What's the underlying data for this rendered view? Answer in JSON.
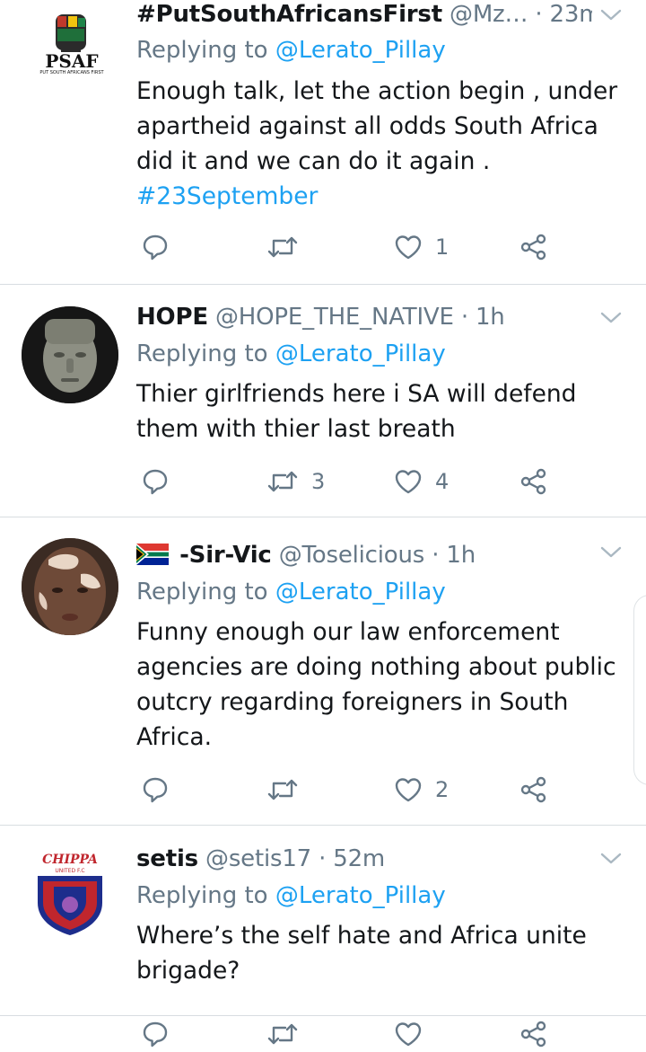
{
  "tweets": [
    {
      "name": "#PutSouthAfricansFirst",
      "handle": "@Mz…",
      "dot": "·",
      "time": "23m",
      "replying_prefix": "Replying to ",
      "replying_to": "@Lerato_Pillay",
      "text": "Enough talk, let the action begin , under\napartheid against all odds South Africa\ndid it and we can do it again .",
      "hashtag": "#23September",
      "avatar_logo_text": "PSAF",
      "avatar_logo_sub": "PUT SOUTH AFRICANS FIRST",
      "retweets": "",
      "likes": "1"
    },
    {
      "name": "HOPE",
      "handle": "@HOPE_THE_NATIVE",
      "dot": "·",
      "time": "1h",
      "replying_prefix": "Replying to ",
      "replying_to": "@Lerato_Pillay",
      "text": "Thier girlfriends here i  SA will defend\nthem with thier last breath",
      "retweets": "3",
      "likes": "4"
    },
    {
      "name": "-Sir-Vic",
      "handle": "@Toselicious",
      "dot": "·",
      "time": "1h",
      "replying_prefix": "Replying to ",
      "replying_to": "@Lerato_Pillay",
      "text": "Funny enough our law enforcement\nagencies are doing nothing about public\noutcry regarding foreigners in South\nAfrica.",
      "retweets": "",
      "likes": "2"
    },
    {
      "name": "setis",
      "handle": "@setis17",
      "dot": "·",
      "time": "52m",
      "replying_prefix": "Replying to ",
      "replying_to": "@Lerato_Pillay",
      "text": "Where’s the self hate and Africa unite\nbrigade?",
      "avatar_logo_text": "CHIPPA",
      "avatar_logo_sub": "UNITED F.C"
    }
  ],
  "colors": {
    "link": "#1da1f2",
    "secondary_text": "#657786",
    "divider": "#d8dde1"
  },
  "icons": [
    "reply-icon",
    "retweet-icon",
    "like-icon",
    "share-icon",
    "chevron-down-icon",
    "south-africa-flag-icon"
  ]
}
